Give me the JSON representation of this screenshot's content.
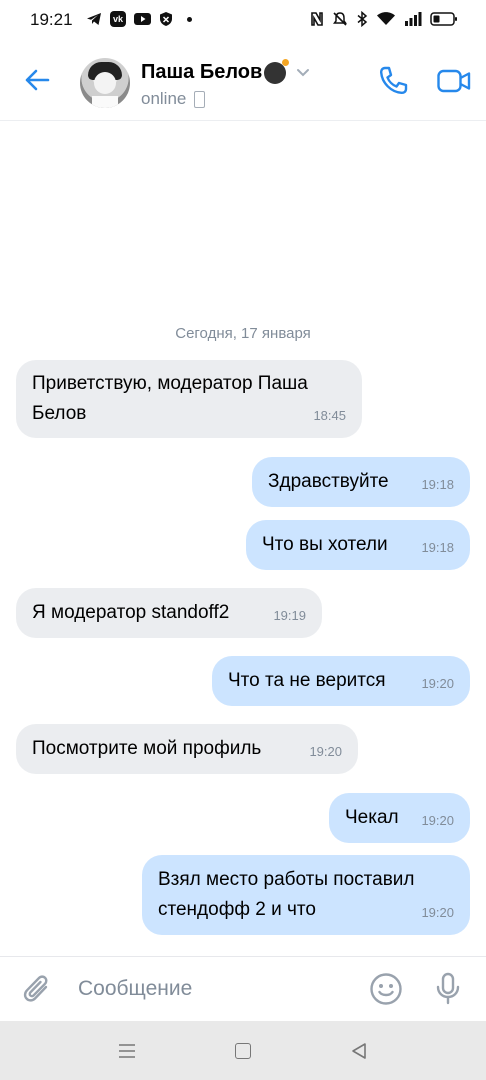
{
  "status_bar": {
    "time": "19:21",
    "left_icons": [
      "telegram-icon",
      "vk-icon",
      "youtube-icon",
      "shield-icon"
    ],
    "right_icons": [
      "nfc-icon",
      "mute-icon",
      "bluetooth-icon",
      "wifi-icon",
      "signal-icon",
      "battery-icon"
    ]
  },
  "header": {
    "name": "Паша Белов",
    "status": "online"
  },
  "chat": {
    "date_separator": "Сегодня, 17 января",
    "messages": [
      {
        "direction": "in",
        "text": "Приветствую, модератор Паша Белов",
        "time": "18:45"
      },
      {
        "direction": "out",
        "text": "Здравствуйте",
        "time": "19:18"
      },
      {
        "direction": "out",
        "text": "Что вы хотели",
        "time": "19:18"
      },
      {
        "direction": "in",
        "text": "Я модератор standoff2",
        "time": "19:19"
      },
      {
        "direction": "out",
        "text": "Что та не верится",
        "time": "19:20"
      },
      {
        "direction": "in",
        "text": "Посмотрите мой профиль",
        "time": "19:20"
      },
      {
        "direction": "out",
        "text": "Чекал",
        "time": "19:20"
      },
      {
        "direction": "out",
        "text": "Взял место работы поставил стендофф 2 и что",
        "time": "19:20"
      }
    ]
  },
  "composer": {
    "placeholder": "Сообщение"
  },
  "colors": {
    "accent": "#2688eb",
    "incoming_bubble": "#ebedf0",
    "outgoing_bubble": "#cce4ff",
    "secondary_text": "#818c99"
  }
}
